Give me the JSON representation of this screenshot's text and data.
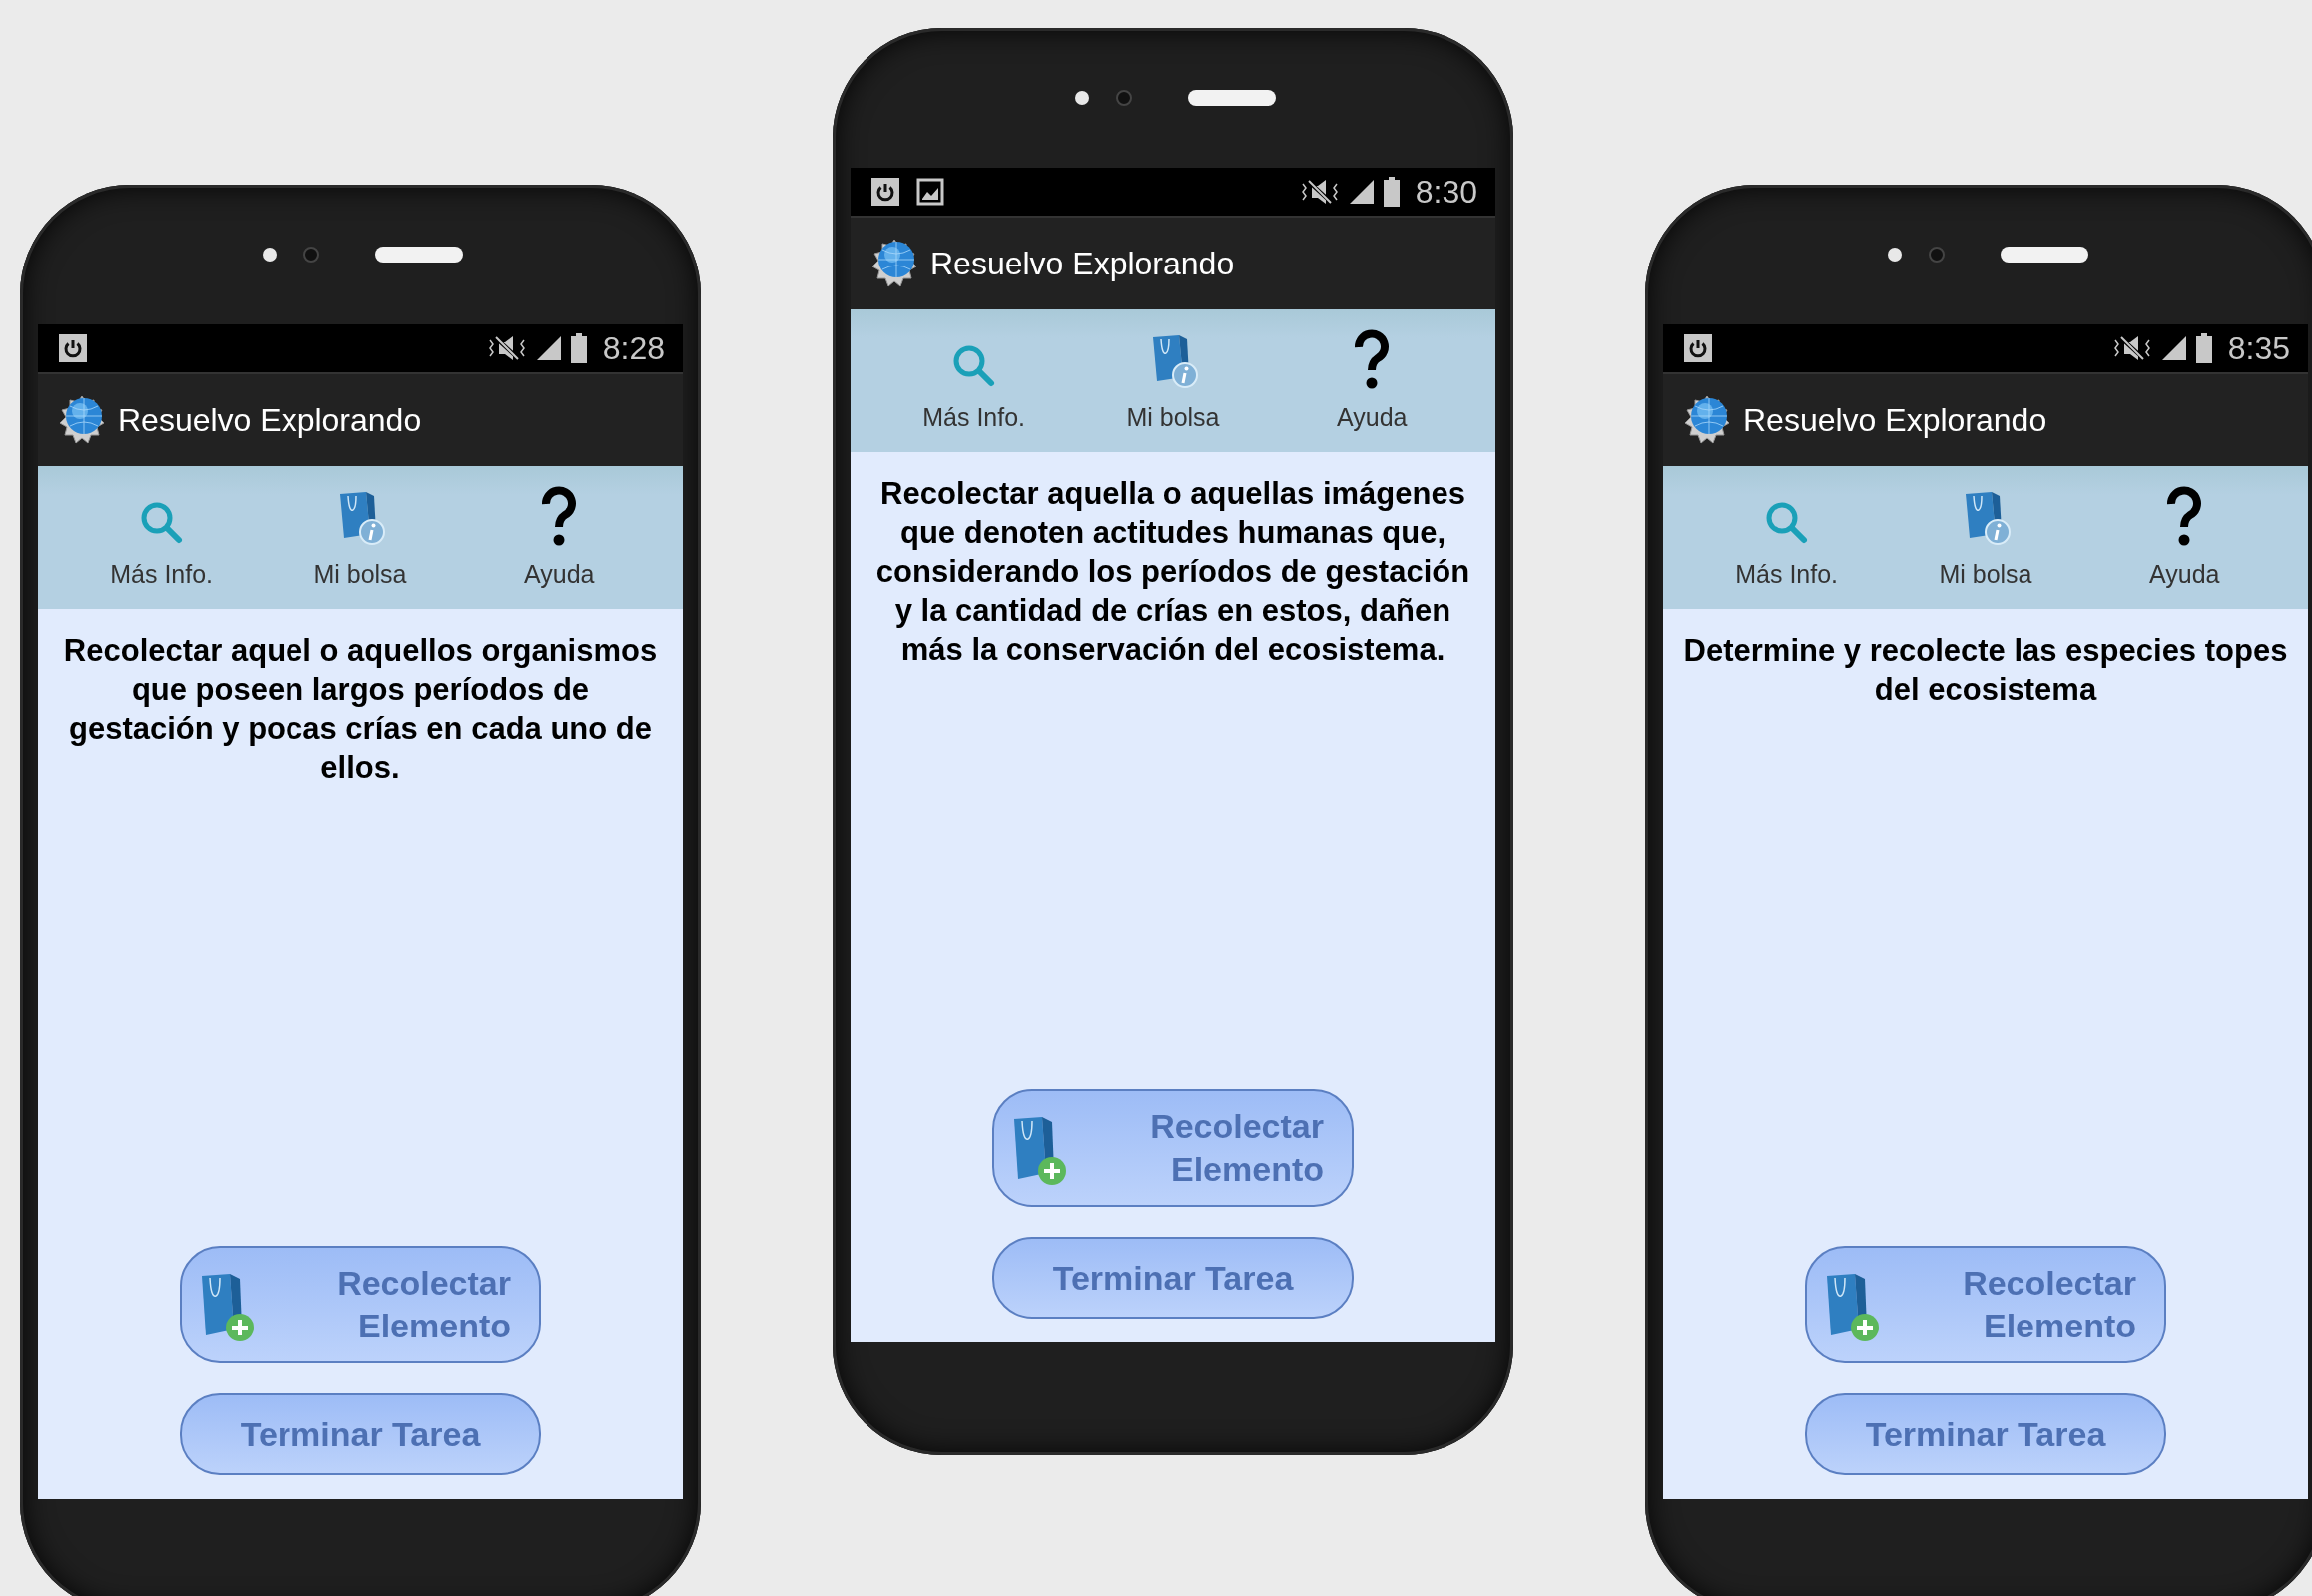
{
  "phones": [
    {
      "status_bar": {
        "notifications": [
          {
            "kind": "power"
          }
        ],
        "time": "8:28"
      },
      "app_bar": {
        "title": "Resuelvo Explorando"
      },
      "toolbar": [
        {
          "kind": "search",
          "label": "Más Info."
        },
        {
          "kind": "bag",
          "label": "Mi bolsa"
        },
        {
          "kind": "help",
          "label": "Ayuda"
        }
      ],
      "task": "Recolectar aquel o aquellos organismos que poseen largos períodos de gestación y pocas crías en cada uno de ellos.",
      "buttons": [
        {
          "kind": "collect",
          "label": "Recolectar Elemento"
        },
        {
          "kind": "finish",
          "label": "Terminar Tarea"
        }
      ]
    },
    {
      "status_bar": {
        "notifications": [
          {
            "kind": "power"
          },
          {
            "kind": "picture"
          }
        ],
        "time": "8:30"
      },
      "app_bar": {
        "title": "Resuelvo Explorando"
      },
      "toolbar": [
        {
          "kind": "search",
          "label": "Más Info."
        },
        {
          "kind": "bag",
          "label": "Mi bolsa"
        },
        {
          "kind": "help",
          "label": "Ayuda"
        }
      ],
      "task": "Recolectar aquella o aquellas imágenes que denoten actitudes humanas que, considerando los períodos de gestación y la cantidad de crías en estos, dañen más la conservación del ecosistema.",
      "buttons": [
        {
          "kind": "collect",
          "label": "Recolectar Elemento"
        },
        {
          "kind": "finish",
          "label": "Terminar Tarea"
        }
      ]
    },
    {
      "status_bar": {
        "notifications": [
          {
            "kind": "power"
          }
        ],
        "time": "8:35"
      },
      "app_bar": {
        "title": "Resuelvo Explorando"
      },
      "toolbar": [
        {
          "kind": "search",
          "label": "Más Info."
        },
        {
          "kind": "bag",
          "label": "Mi bolsa"
        },
        {
          "kind": "help",
          "label": "Ayuda"
        }
      ],
      "task": "Determine y recolecte las especies topes del ecosistema",
      "buttons": [
        {
          "kind": "collect",
          "label": "Recolectar Elemento"
        },
        {
          "kind": "finish",
          "label": "Terminar Tarea"
        }
      ]
    }
  ]
}
